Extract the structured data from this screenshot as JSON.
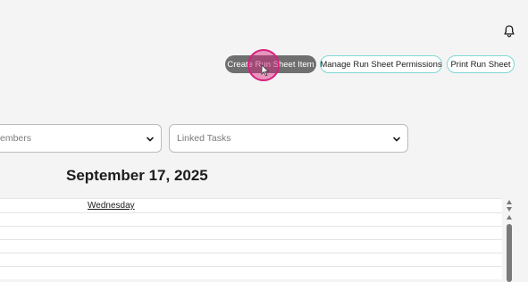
{
  "header": {
    "notification_icon": "bell-icon"
  },
  "toolbar": {
    "create_label": "Create Run Sheet Item",
    "permissions_label": "Manage Run Sheet Permissions",
    "print_label": "Print Run Sheet"
  },
  "filters": {
    "members_placeholder": "embers",
    "tasks_placeholder": "Linked Tasks",
    "chevron_icon": "chevron-down-icon"
  },
  "schedule": {
    "date": "September 17, 2025",
    "day": "Wednesday"
  },
  "colors": {
    "primary_button": "#6f6f6f",
    "outline_accent": "#7fd8d4",
    "cursor_highlight": "#d6217c"
  }
}
